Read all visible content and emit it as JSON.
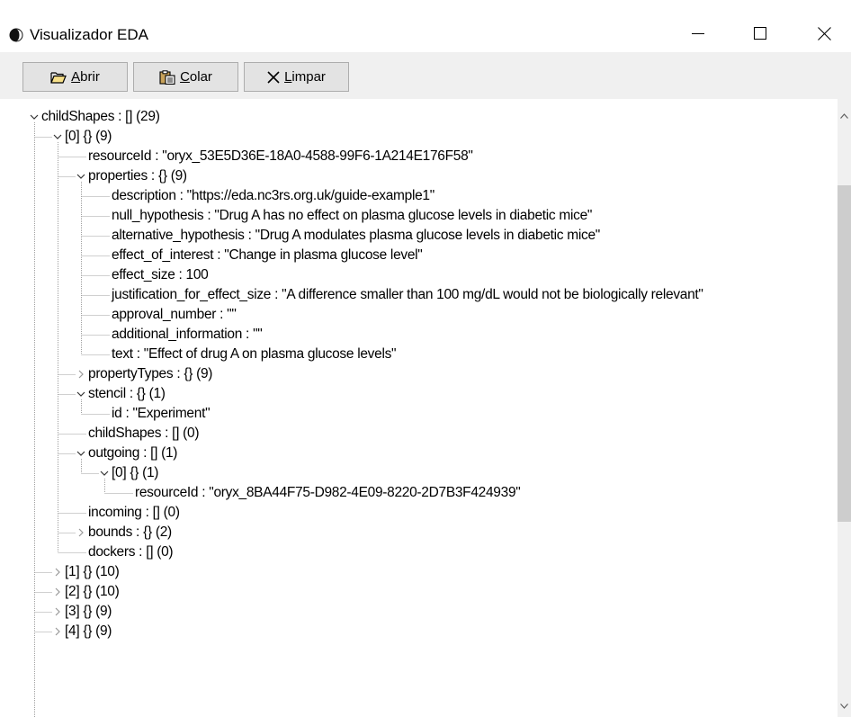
{
  "window": {
    "title": "Visualizador EDA",
    "controls": [
      "minimize",
      "maximize",
      "close"
    ]
  },
  "toolbar": {
    "open_label_key": "A",
    "open_label_rest": "brir",
    "paste_label_key": "C",
    "paste_label_rest": "olar",
    "clear_label_key": "L",
    "clear_label_rest": "impar",
    "open_icon": "folder-open-icon",
    "paste_icon": "clipboard-icon",
    "clear_icon": "x-icon"
  },
  "tree": {
    "rows": [
      {
        "text": "childShapes : [] (29)",
        "depth": 0,
        "toggle": "expanded"
      },
      {
        "text": "[0]  {} (9)",
        "depth": 1,
        "toggle": "expanded"
      },
      {
        "text": "resourceId : \"oryx_53E5D36E-18A0-4588-99F6-1A214E176F58\"",
        "depth": 2,
        "toggle": "leaf"
      },
      {
        "text": "properties :  {} (9)",
        "depth": 2,
        "toggle": "expanded"
      },
      {
        "text": "description : \"https://eda.nc3rs.org.uk/guide-example1\"",
        "depth": 3,
        "toggle": "leaf"
      },
      {
        "text": "null_hypothesis : \"Drug A has no effect on plasma glucose levels in diabetic mice\"",
        "depth": 3,
        "toggle": "leaf"
      },
      {
        "text": "alternative_hypothesis : \"Drug A modulates plasma glucose levels in diabetic mice\"",
        "depth": 3,
        "toggle": "leaf"
      },
      {
        "text": "effect_of_interest : \"Change in plasma glucose level\"",
        "depth": 3,
        "toggle": "leaf"
      },
      {
        "text": "effect_size : 100",
        "depth": 3,
        "toggle": "leaf"
      },
      {
        "text": "justification_for_effect_size : \"A difference smaller than 100 mg/dL would not be biologically relevant\"",
        "depth": 3,
        "toggle": "leaf"
      },
      {
        "text": "approval_number : \"\"",
        "depth": 3,
        "toggle": "leaf"
      },
      {
        "text": "additional_information : \"\"",
        "depth": 3,
        "toggle": "leaf"
      },
      {
        "text": "text : \"Effect of drug A on plasma glucose levels\"",
        "depth": 3,
        "toggle": "leaf"
      },
      {
        "text": "propertyTypes :  {} (9)",
        "depth": 2,
        "toggle": "collapsed"
      },
      {
        "text": "stencil :  {} (1)",
        "depth": 2,
        "toggle": "expanded"
      },
      {
        "text": "id : \"Experiment\"",
        "depth": 3,
        "toggle": "leaf"
      },
      {
        "text": "childShapes :  [] (0)",
        "depth": 2,
        "toggle": "leaf"
      },
      {
        "text": "outgoing :  [] (1)",
        "depth": 2,
        "toggle": "expanded"
      },
      {
        "text": "[0]  {} (1)",
        "depth": 3,
        "toggle": "expanded"
      },
      {
        "text": "resourceId : \"oryx_8BA44F75-D982-4E09-8220-2D7B3F424939\"",
        "depth": 4,
        "toggle": "leaf"
      },
      {
        "text": "incoming :  [] (0)",
        "depth": 2,
        "toggle": "leaf"
      },
      {
        "text": "bounds :  {} (2)",
        "depth": 2,
        "toggle": "collapsed"
      },
      {
        "text": "dockers :  [] (0)",
        "depth": 2,
        "toggle": "leaf"
      },
      {
        "text": "[1]  {} (10)",
        "depth": 1,
        "toggle": "collapsed"
      },
      {
        "text": "[2]  {} (10)",
        "depth": 1,
        "toggle": "collapsed"
      },
      {
        "text": "[3]  {} (9)",
        "depth": 1,
        "toggle": "collapsed"
      },
      {
        "text": "[4]  {} (9)",
        "depth": 1,
        "toggle": "collapsed"
      }
    ]
  }
}
